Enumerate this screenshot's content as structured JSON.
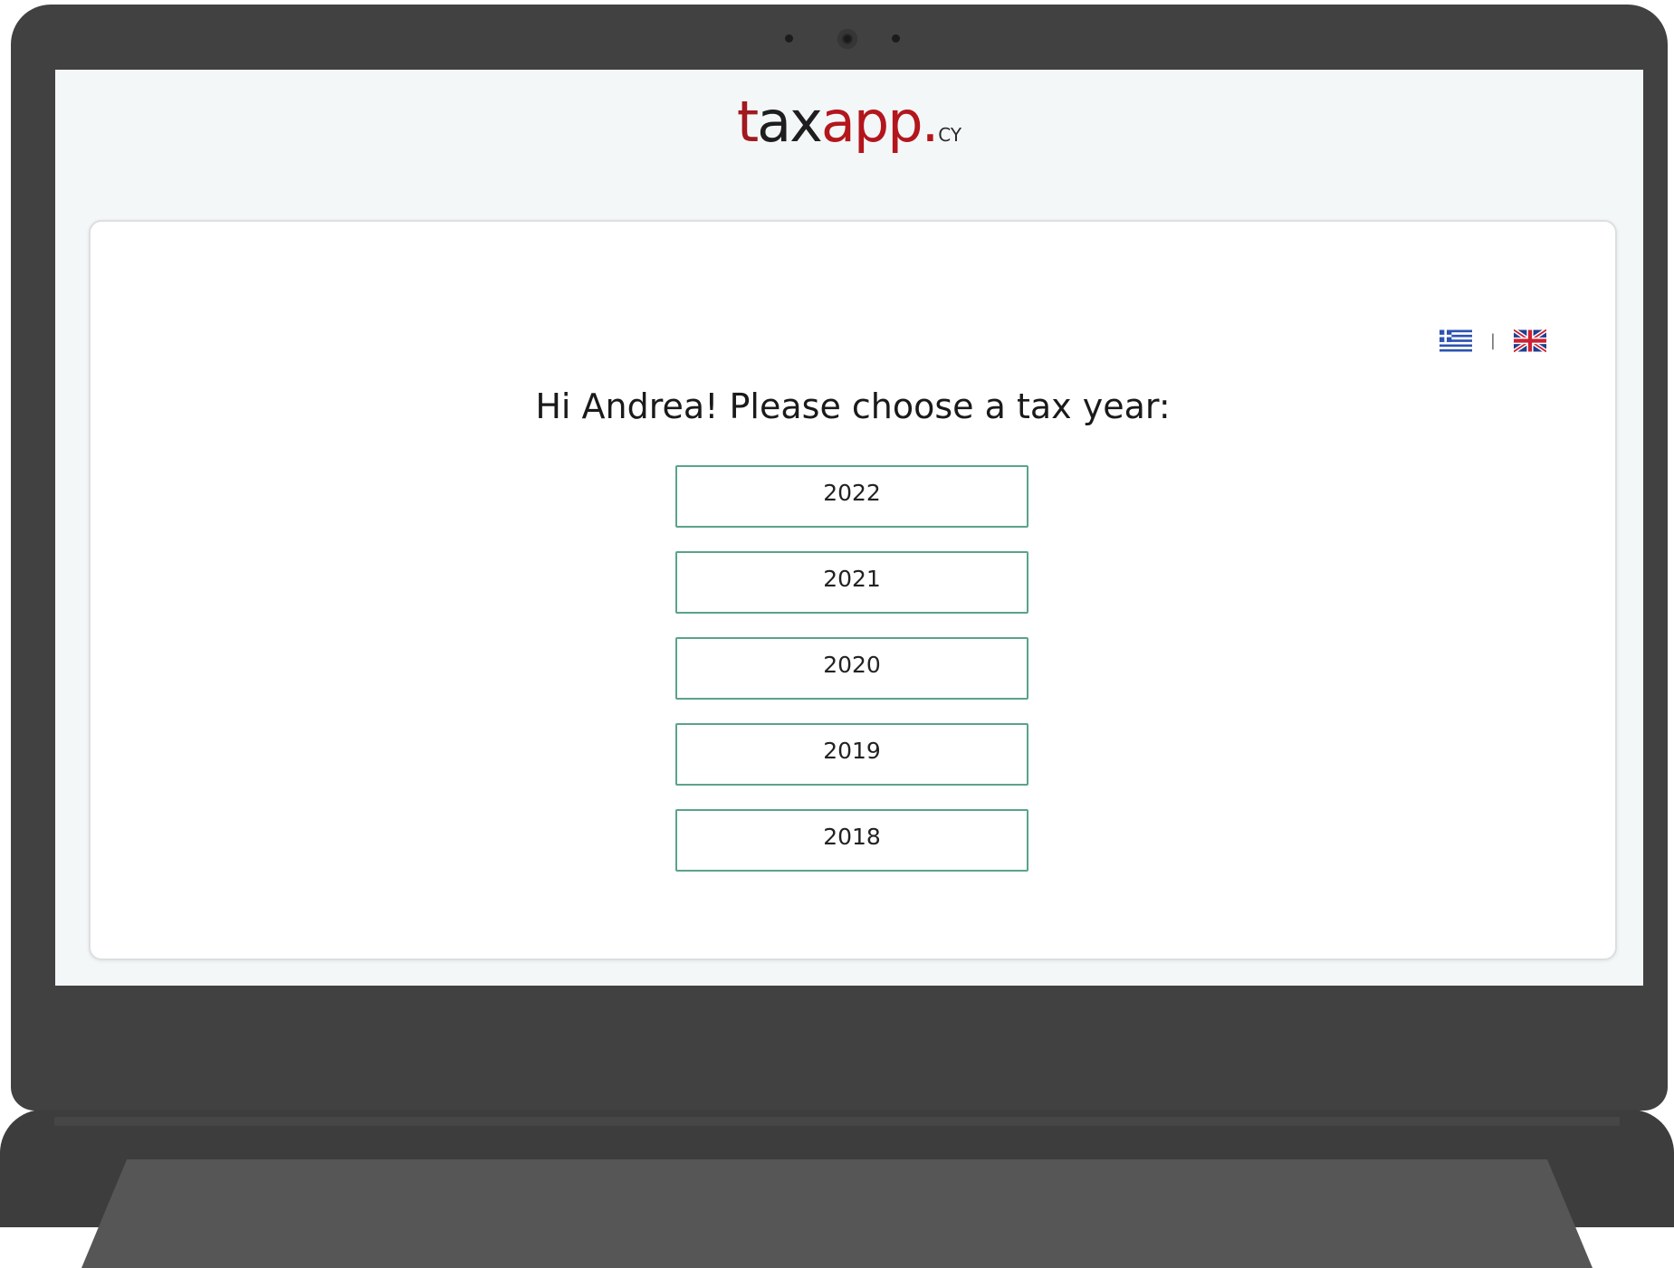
{
  "logo": {
    "part1": "t",
    "part2": "ax",
    "part3": "app",
    "dot": ".",
    "suffix": "CY"
  },
  "greeting": "Hi Andrea! Please choose a tax year:",
  "language": {
    "separator": "|",
    "options": [
      "greek-flag-icon",
      "uk-flag-icon"
    ]
  },
  "tax_years": [
    "2022",
    "2021",
    "2020",
    "2019",
    "2018"
  ],
  "colors": {
    "brand_red": "#b3161c",
    "button_border": "#5aa38a",
    "bezel": "#414141"
  }
}
